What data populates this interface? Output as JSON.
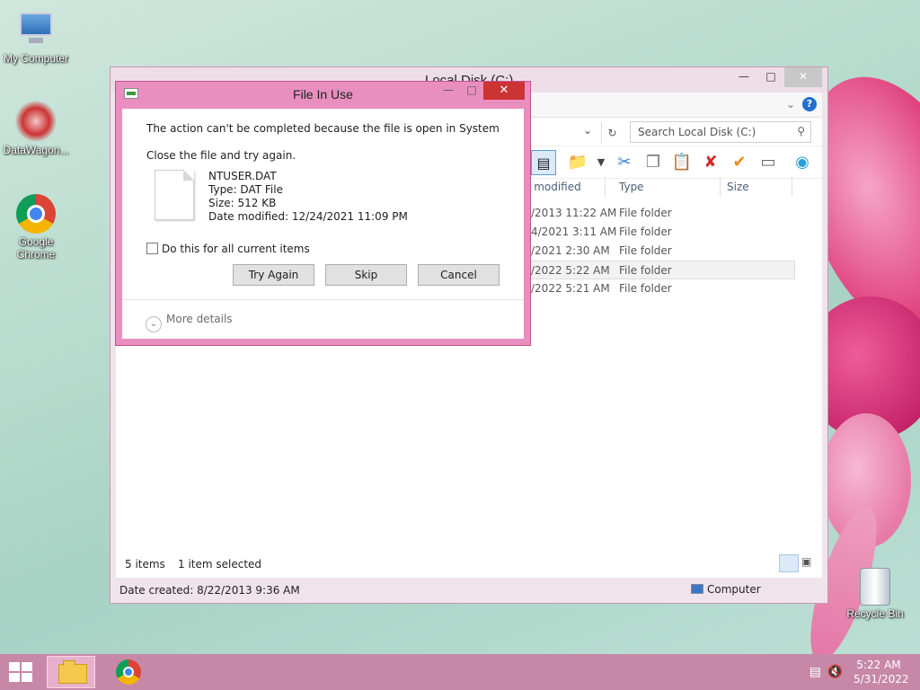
{
  "desktop": {
    "icons": [
      {
        "label": "My Computer"
      },
      {
        "label": "DataWagon..."
      },
      {
        "label": "Google Chrome"
      },
      {
        "label": "Recycle Bin"
      }
    ]
  },
  "explorer": {
    "title": "Local Disk (C:)",
    "search_placeholder": "Search Local Disk (C:)",
    "columns": {
      "modified": "e modified",
      "type": "Type",
      "size": "Size"
    },
    "rows": [
      {
        "date": "/2013 11:22 AM",
        "type": "File folder",
        "selected": false
      },
      {
        "date": "4/2021 3:11 AM",
        "type": "File folder",
        "selected": false
      },
      {
        "date": "/2021 2:30 AM",
        "type": "File folder",
        "selected": false
      },
      {
        "date": "/2022 5:22 AM",
        "type": "File folder",
        "selected": true
      },
      {
        "date": "/2022 5:21 AM",
        "type": "File folder",
        "selected": false
      }
    ],
    "status": {
      "items": "5 items",
      "selected": "1 item selected"
    },
    "footer": {
      "date_created": "Date created: 8/22/2013 9:36 AM",
      "location": "Computer"
    }
  },
  "dialog": {
    "title": "File In Use",
    "message": "The action can't be completed because the file is open in System",
    "sub": "Close the file and try again.",
    "file": {
      "name": "NTUSER.DAT",
      "type": "Type: DAT File",
      "size": "Size: 512 KB",
      "modified": "Date modified: 12/24/2021 11:09 PM"
    },
    "checkbox_label": "Do this for all current items",
    "checkbox_checked": false,
    "buttons": {
      "try_again": "Try Again",
      "skip": "Skip",
      "cancel": "Cancel"
    },
    "more_details": "More details"
  },
  "taskbar": {
    "time": "5:22 AM",
    "date": "5/31/2022"
  },
  "colors": {
    "dialog_frame": "#e98fc0",
    "close_button": "#cc3333",
    "taskbar": "#c788a7"
  }
}
